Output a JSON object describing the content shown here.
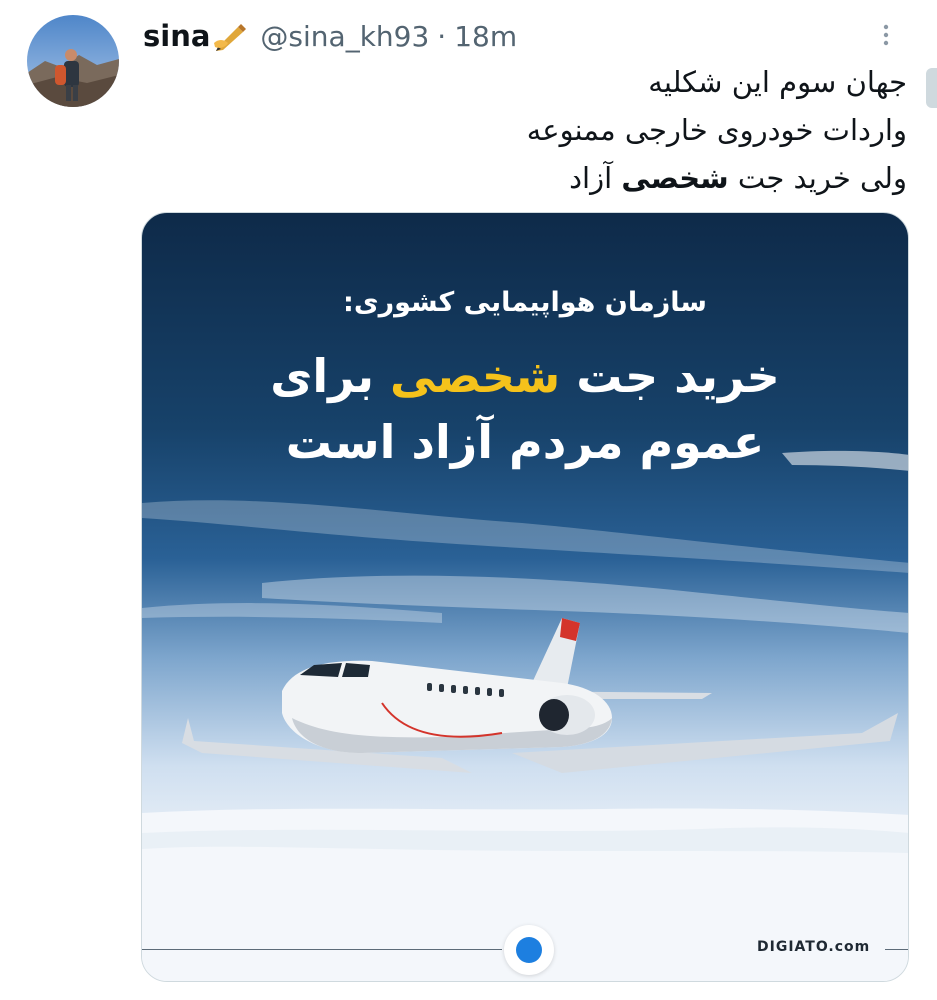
{
  "tweet": {
    "display_name": "sina",
    "handle": "@sina_kh93",
    "separator": "·",
    "time": "18m",
    "text_line_1": "جهان سوم این شکلیه",
    "text_line_2": "واردات خودروی خارجی ممنوعه",
    "text_line_3_a": "ولی خرید جت ",
    "text_line_3_b": "شخصی",
    "text_line_3_c": " آزاد"
  },
  "icons": {
    "name_emoji": "writing-hand-icon",
    "more": "more-options-icon"
  },
  "media": {
    "subtitle": "سازمان هواپیمایی کشوری:",
    "headline_a": "خرید جت ",
    "headline_b": "شخصی",
    "headline_c": " برای",
    "headline_line_2": "عموم مردم آزاد است",
    "brand": "DIGIATO.com",
    "highlight_color": "#f5c21b",
    "brand_logo_color": "#1d7fe0"
  }
}
